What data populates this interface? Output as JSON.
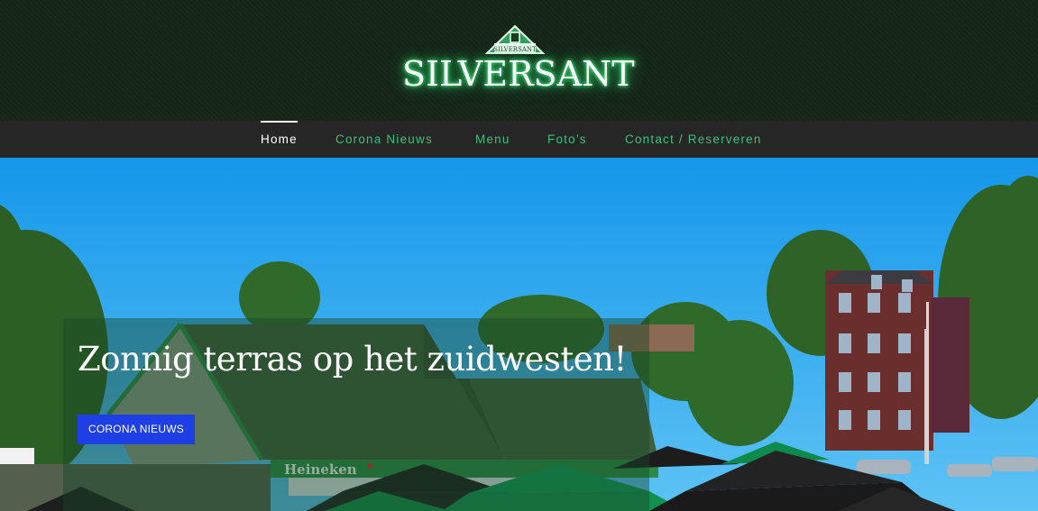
{
  "logo": {
    "main_text": "SILVERSANT",
    "badge_text": "SILVERSANT"
  },
  "nav": {
    "items": [
      {
        "label": "Home",
        "active": true
      },
      {
        "label": "Corona Nieuws",
        "active": false
      },
      {
        "label": "Menu",
        "active": false
      },
      {
        "label": "Foto’s",
        "active": false
      },
      {
        "label": "Contact / Reserveren",
        "active": false
      }
    ]
  },
  "hero": {
    "title": "Zonnig terras op het zuidwesten!",
    "button_label": "CORONA NIEUWS",
    "awning_text": "Heineken"
  },
  "colors": {
    "header_bg": "#152518",
    "nav_bg": "#262626",
    "nav_link": "#3fbf79",
    "nav_active": "#ffffff",
    "button_bg": "#1e3fe6"
  }
}
